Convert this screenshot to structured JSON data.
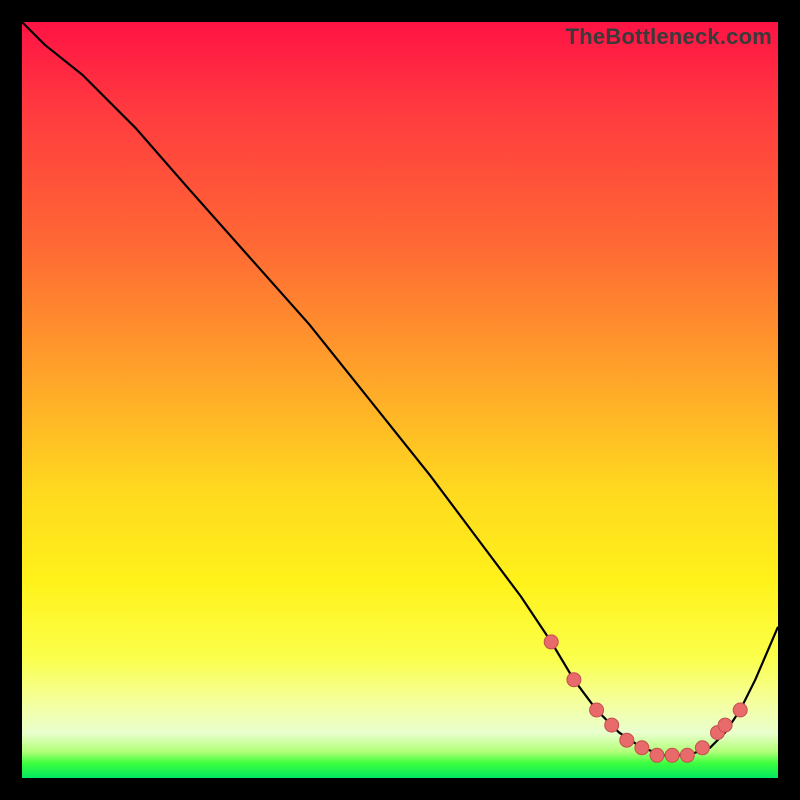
{
  "watermark": "TheBottleneck.com",
  "colors": {
    "curve_stroke": "#000000",
    "marker_fill": "#e86a6a",
    "marker_stroke": "#c44f4f"
  },
  "chart_data": {
    "type": "line",
    "title": "",
    "xlabel": "",
    "ylabel": "",
    "xlim": [
      0,
      100
    ],
    "ylim": [
      0,
      100
    ],
    "x": [
      0,
      3,
      8,
      15,
      22,
      30,
      38,
      46,
      54,
      60,
      66,
      70,
      73,
      76,
      79,
      82,
      85,
      88,
      91,
      93,
      95,
      97,
      100
    ],
    "y": [
      100,
      97,
      93,
      86,
      78,
      69,
      60,
      50,
      40,
      32,
      24,
      18,
      13,
      9,
      6,
      4,
      3,
      3,
      4,
      6,
      9,
      13,
      20
    ],
    "markers_x": [
      70,
      73,
      76,
      78,
      80,
      82,
      84,
      86,
      88,
      90,
      92,
      93,
      95
    ],
    "markers_y": [
      18,
      13,
      9,
      7,
      5,
      4,
      3,
      3,
      3,
      4,
      6,
      7,
      9
    ]
  }
}
